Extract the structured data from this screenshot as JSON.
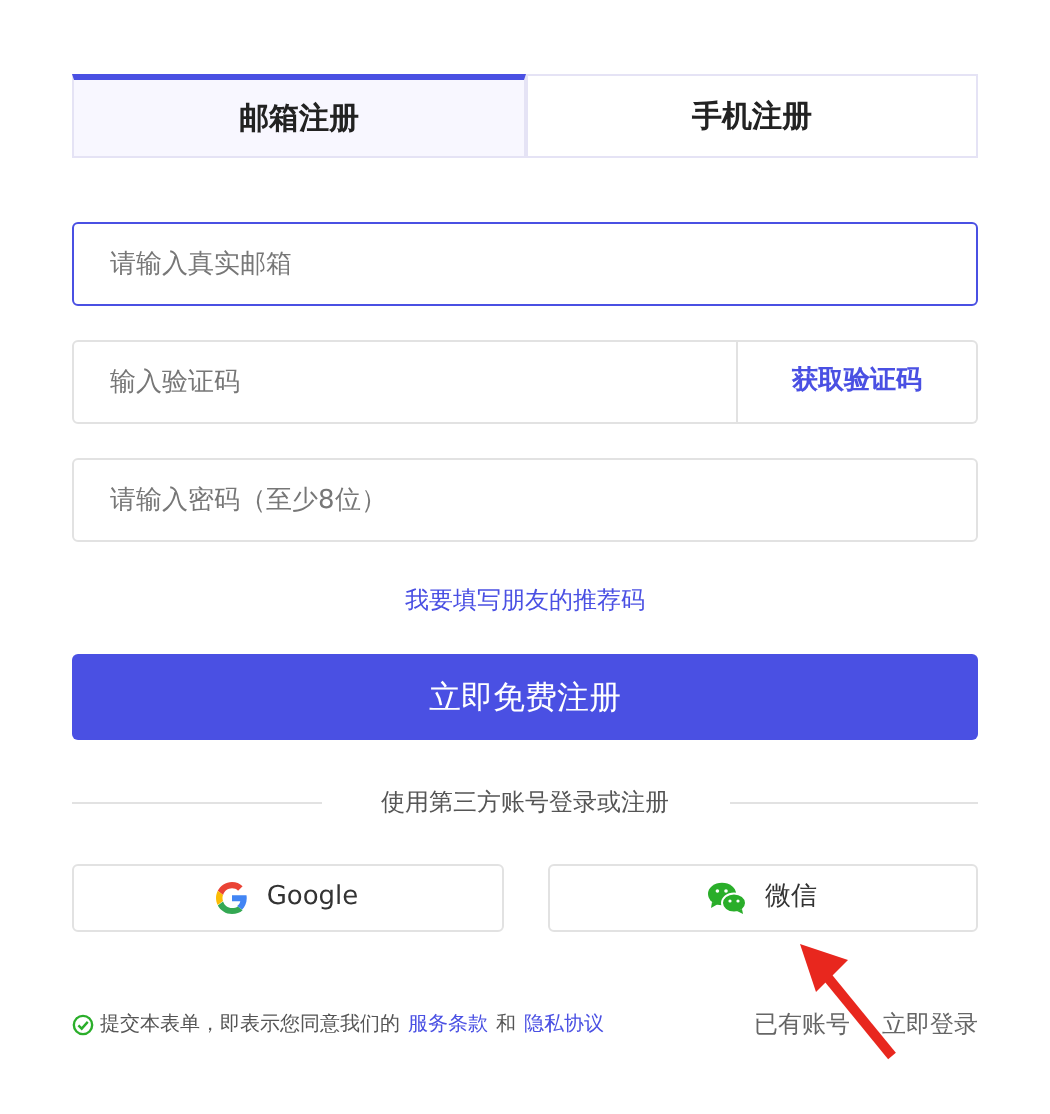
{
  "tabs": [
    {
      "label": "邮箱注册",
      "selected": true
    },
    {
      "label": "手机注册",
      "selected": false
    }
  ],
  "fields": [
    {
      "placeholder": "请输入真实邮箱",
      "focused": true
    },
    {
      "placeholder": "输入验证码",
      "focused": false,
      "action": "获取验证码"
    },
    {
      "placeholder": "请输入密码（至少8位）",
      "focused": false
    }
  ],
  "referral_link": "我要填写朋友的推荐码",
  "submit_button": "立即免费注册",
  "divider_text": "使用第三方账号登录或注册",
  "social_buttons": [
    {
      "kind": "google",
      "label": "Google"
    },
    {
      "kind": "wechat",
      "label": "微信"
    }
  ],
  "footer": {
    "agreement": "提交本表单，即表示您同意我们的",
    "terms_link": "服务条款",
    "and": "和",
    "privacy_link": "隐私协议",
    "login_text": "已有账号",
    "login_link": "立即登录"
  }
}
